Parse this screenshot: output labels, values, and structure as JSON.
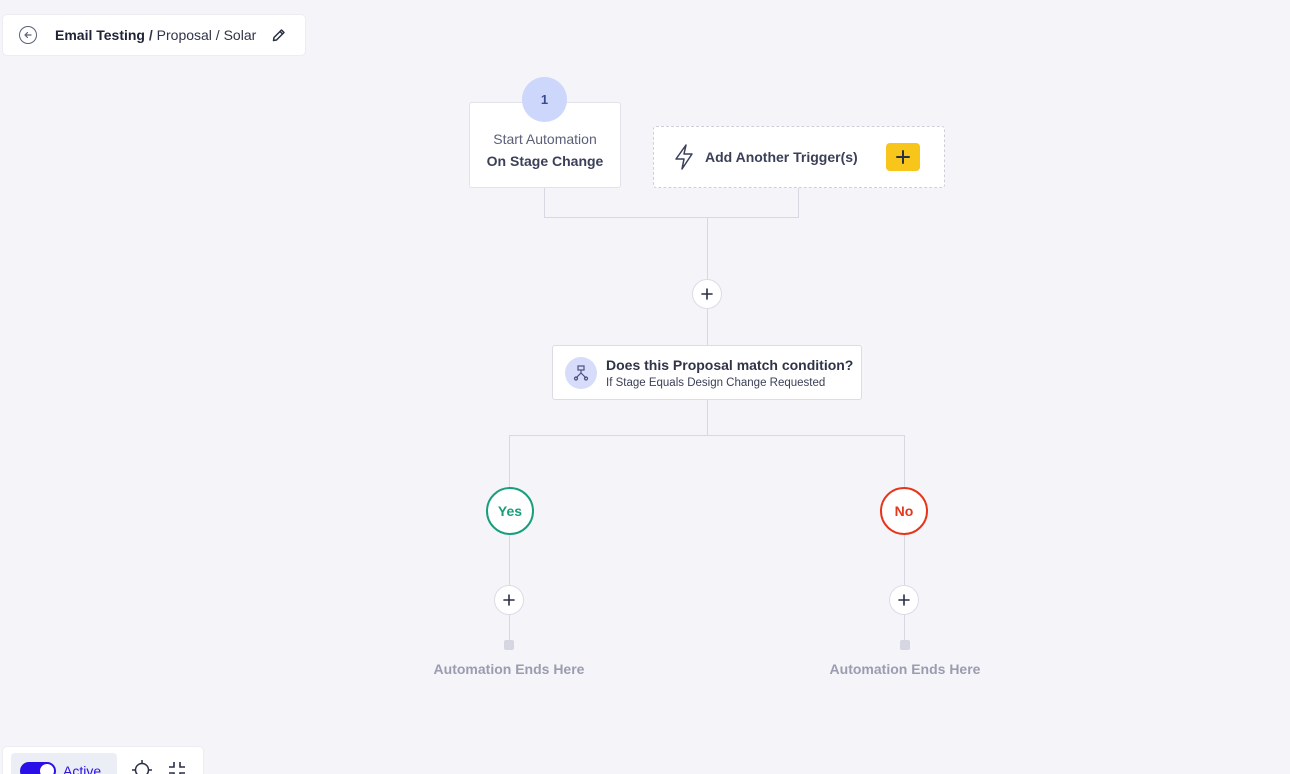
{
  "breadcrumb": {
    "title": "Email Testing",
    "separator": "/",
    "path": "Proposal / Solar"
  },
  "start": {
    "step_number": "1",
    "line1": "Start Automation",
    "line2": "On Stage Change"
  },
  "trigger": {
    "label": "Add Another Trigger(s)",
    "accent": "#f8c51a"
  },
  "condition": {
    "title": "Does this Proposal match condition?",
    "subtitle": "If Stage Equals Design Change Requested"
  },
  "branches": {
    "yes_label": "Yes",
    "no_label": "No",
    "yes_color": "#199e7c",
    "no_color": "#e5361b",
    "end_text_yes": "Automation Ends Here",
    "end_text_no": "Automation Ends Here"
  },
  "toolbar": {
    "status_label": "Active",
    "status_color": "#2a10e6",
    "icons": [
      "crosshair-icon",
      "collapse-icon"
    ]
  }
}
